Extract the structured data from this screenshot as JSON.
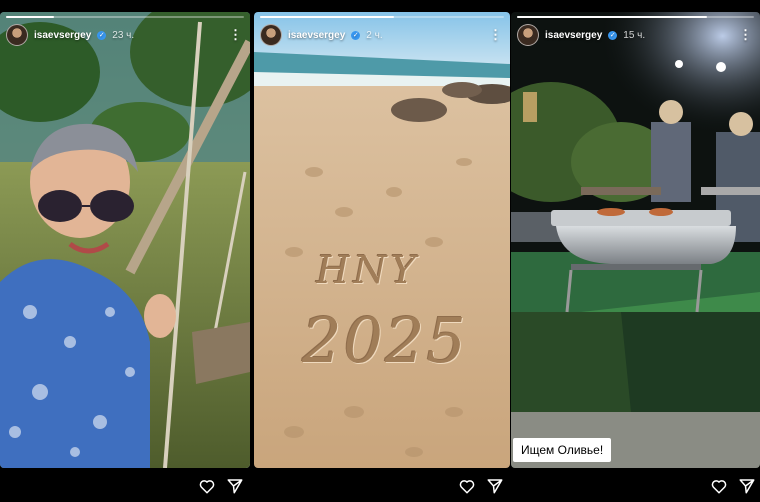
{
  "stories": [
    {
      "username": "isaevsergey",
      "timestamp": "23 ч.",
      "progress": 0.2
    },
    {
      "username": "isaevsergey",
      "timestamp": "2 ч.",
      "progress": 0.55,
      "sand_text": [
        "HNY",
        "2025"
      ]
    },
    {
      "username": "isaevsergey",
      "timestamp": "15 ч.",
      "progress": 0.8,
      "caption": "Ищем Оливье!"
    }
  ],
  "icons": {
    "verified": "verified-badge-icon",
    "menu": "more-vertical-icon",
    "like": "heart-icon",
    "share": "send-icon"
  },
  "colors": {
    "background": "#000000",
    "verified": "#3897f0",
    "text": "#ffffff"
  }
}
